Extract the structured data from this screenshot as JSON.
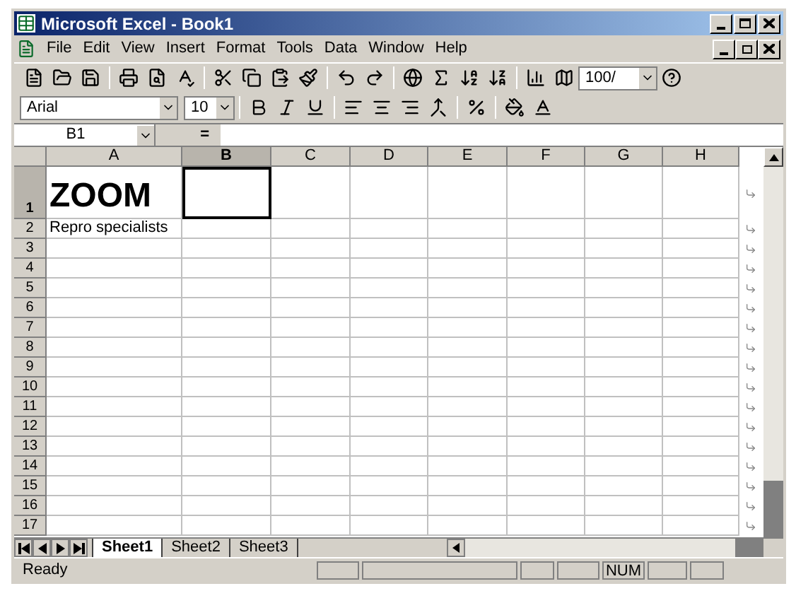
{
  "window": {
    "title": "Microsoft Excel - Book1"
  },
  "menu": [
    "File",
    "Edit",
    "View",
    "Insert",
    "Format",
    "Tools",
    "Data",
    "Window",
    "Help"
  ],
  "standard_toolbar": {
    "zoom": "100/"
  },
  "formatting_toolbar": {
    "font": "Arial",
    "size": "10"
  },
  "formula_bar": {
    "name_box": "B1",
    "equals": "="
  },
  "columns": [
    {
      "label": "A",
      "selected": false
    },
    {
      "label": "B",
      "selected": true
    },
    {
      "label": "C",
      "selected": false
    },
    {
      "label": "D",
      "selected": false
    },
    {
      "label": "E",
      "selected": false
    },
    {
      "label": "F",
      "selected": false
    },
    {
      "label": "G",
      "selected": false
    },
    {
      "label": "H",
      "selected": false
    }
  ],
  "rows": [
    {
      "header": "1",
      "selected": true,
      "column_a": {
        "text": "ZOOM",
        "kind": "title"
      }
    },
    {
      "header": "2",
      "selected": false,
      "column_a": {
        "text": "Repro specialists",
        "kind": "plain"
      }
    },
    {
      "header": "3",
      "selected": false
    },
    {
      "header": "4",
      "selected": false
    },
    {
      "header": "5",
      "selected": false
    },
    {
      "header": "6",
      "selected": false
    },
    {
      "header": "7",
      "selected": false
    },
    {
      "header": "8",
      "selected": false
    },
    {
      "header": "9",
      "selected": false
    },
    {
      "header": "10",
      "selected": false
    },
    {
      "header": "11",
      "selected": false
    },
    {
      "header": "12",
      "selected": false
    },
    {
      "header": "13",
      "selected": false
    },
    {
      "header": "14",
      "selected": false
    },
    {
      "header": "15",
      "selected": false
    },
    {
      "header": "16",
      "selected": false
    },
    {
      "header": "17",
      "selected": false
    }
  ],
  "sheets": [
    {
      "label": "Sheet1",
      "selected": true
    },
    {
      "label": "Sheet2",
      "selected": false
    },
    {
      "label": "Sheet3",
      "selected": false
    }
  ],
  "status_bar": {
    "text": "Ready",
    "num": "NUM"
  }
}
